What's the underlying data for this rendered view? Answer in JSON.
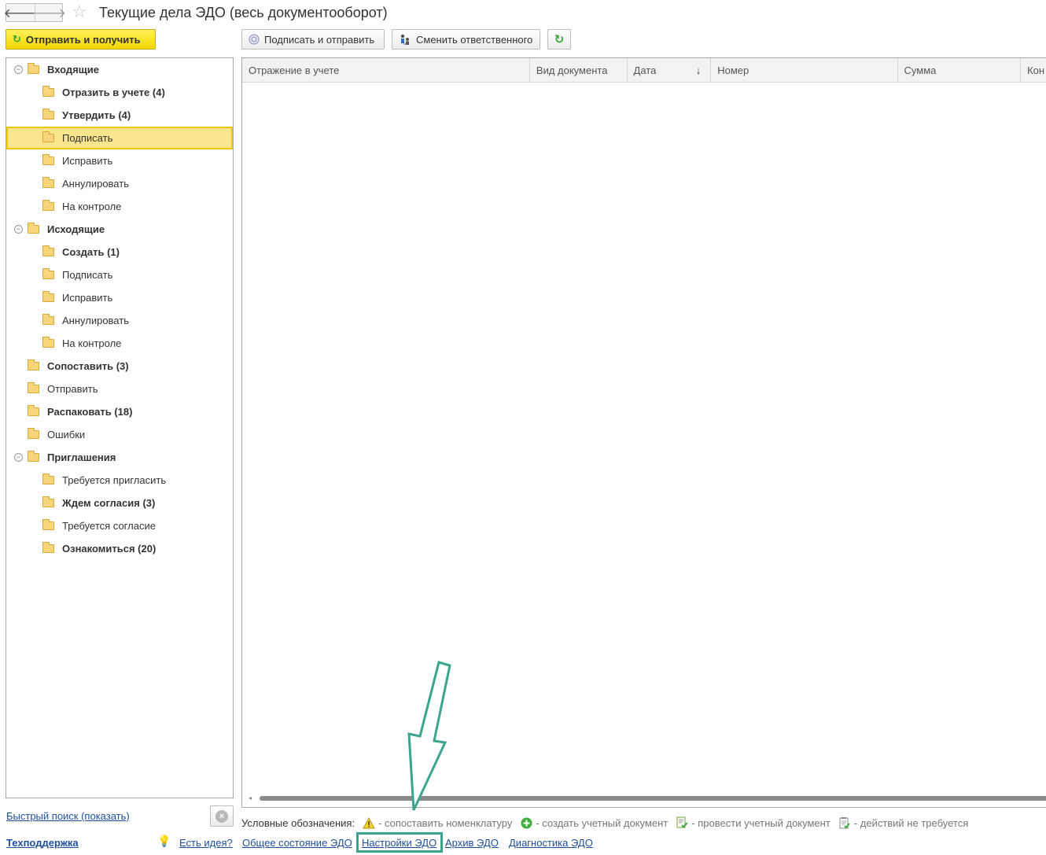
{
  "header": {
    "back_icon": "arrow-left-icon",
    "forward_icon": "arrow-right-icon",
    "favorite_icon": "star-icon",
    "title": "Текущие дела ЭДО (весь документооборот)"
  },
  "toolbar": {
    "send_receive_label": "Отправить и получить",
    "sign_send_label": "Подписать и отправить",
    "change_responsible_label": "Сменить ответственного",
    "refresh_icon": "refresh-icon"
  },
  "tree": {
    "items": [
      {
        "label": "Входящие",
        "level": 0,
        "bold": true,
        "toggle": "⊖"
      },
      {
        "label": "Отразить в учете (4)",
        "level": 1,
        "bold": true
      },
      {
        "label": "Утвердить (4)",
        "level": 1,
        "bold": true
      },
      {
        "label": "Подписать",
        "level": 1,
        "bold": false,
        "selected": true
      },
      {
        "label": "Исправить",
        "level": 1,
        "bold": false
      },
      {
        "label": "Аннулировать",
        "level": 1,
        "bold": false
      },
      {
        "label": "На контроле",
        "level": 1,
        "bold": false
      },
      {
        "label": "Исходящие",
        "level": 0,
        "bold": true,
        "toggle": "⊖"
      },
      {
        "label": "Создать (1)",
        "level": 1,
        "bold": true
      },
      {
        "label": "Подписать",
        "level": 1,
        "bold": false
      },
      {
        "label": "Исправить",
        "level": 1,
        "bold": false
      },
      {
        "label": "Аннулировать",
        "level": 1,
        "bold": false
      },
      {
        "label": "На контроле",
        "level": 1,
        "bold": false
      },
      {
        "label": "Сопоставить (3)",
        "level": 0,
        "bold": true
      },
      {
        "label": "Отправить",
        "level": 0,
        "bold": false
      },
      {
        "label": "Распаковать (18)",
        "level": 0,
        "bold": true
      },
      {
        "label": "Ошибки",
        "level": 0,
        "bold": false
      },
      {
        "label": "Приглашения",
        "level": 0,
        "bold": true,
        "toggle": "⊖"
      },
      {
        "label": "Требуется пригласить",
        "level": 1,
        "bold": false
      },
      {
        "label": "Ждем согласия (3)",
        "level": 1,
        "bold": true
      },
      {
        "label": "Требуется согласие",
        "level": 1,
        "bold": false
      },
      {
        "label": "Ознакомиться (20)",
        "level": 1,
        "bold": true
      }
    ]
  },
  "table": {
    "columns": [
      "Отражение в учете",
      "Вид документа",
      "Дата",
      "Номер",
      "Сумма",
      "Кон"
    ],
    "sort_indicator": "↓",
    "rows": []
  },
  "legend": {
    "label": "Условные обозначения:",
    "items": [
      {
        "icon": "warning-icon",
        "text": "- сопоставить номенклатуру"
      },
      {
        "icon": "add-circle-icon",
        "text": "- создать учетный документ"
      },
      {
        "icon": "post-document-icon",
        "text": "- провести учетный документ"
      },
      {
        "icon": "no-action-icon",
        "text": "- действий не требуется"
      }
    ]
  },
  "footer": {
    "quick_search": "Быстрый поиск (показать)",
    "support": "Техподдержка",
    "idea": "Есть идея?",
    "links": [
      "Общее состояние ЭДО",
      "Настройки ЭДО",
      "Архив ЭДО",
      "Диагностика ЭДО"
    ]
  },
  "colors": {
    "accent_yellow": "#f2d500",
    "selection": "#fbe58c",
    "link": "#1f4e9c",
    "annotation": "#3aa58c"
  }
}
